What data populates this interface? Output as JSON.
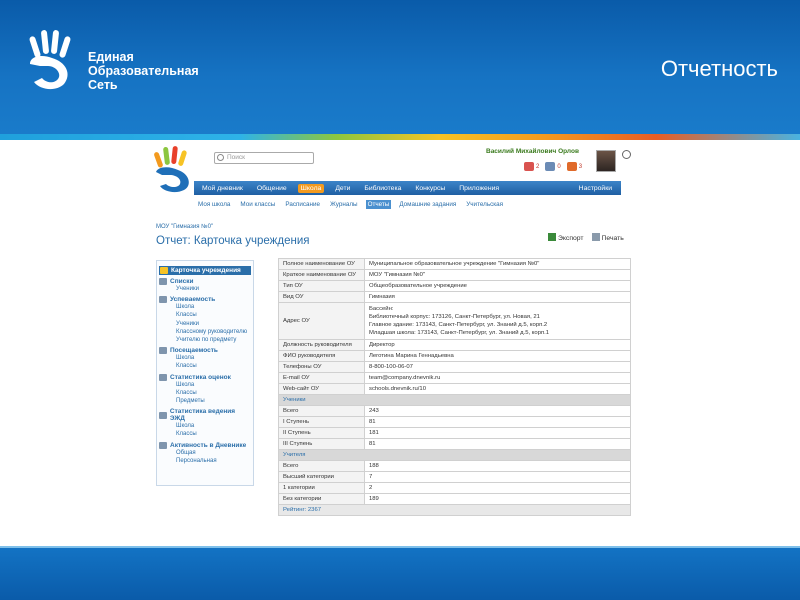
{
  "slide": {
    "title": "Отчетность",
    "logo_lines": [
      "Единая",
      "Образовательная",
      "Сеть"
    ]
  },
  "app": {
    "search_placeholder": "Поиск",
    "user_name": "Василий Михайлович Орлов",
    "badges": [
      {
        "name": "messages",
        "count": "2",
        "color": "#d9534f"
      },
      {
        "name": "friends",
        "count": "0",
        "color": "#6b8bb5"
      },
      {
        "name": "events",
        "count": "3",
        "color": "#e06a2a"
      }
    ],
    "nav": [
      "Мой дневник",
      "Общение",
      "Школа",
      "Дети",
      "Библиотека",
      "Конкурсы",
      "Приложения"
    ],
    "nav_active": "Школа",
    "nav_right": "Настройки",
    "subnav": [
      "Моя школа",
      "Мои классы",
      "Расписание",
      "Журналы",
      "Отчеты",
      "Домашние задания",
      "Учительская"
    ],
    "subnav_active": "Отчеты",
    "breadcrumb": "МОУ \"Гимназия №0\"",
    "page_title": "Отчет: Карточка учреждения",
    "export_label": "Экспорт",
    "print_label": "Печать"
  },
  "sidebar": [
    {
      "title": "Карточка учреждения",
      "active": true,
      "items": []
    },
    {
      "title": "Списки",
      "items": [
        "Ученики"
      ]
    },
    {
      "title": "Успеваемость",
      "items": [
        "Школа",
        "Классы",
        "Ученики",
        "Классному руководителю",
        "Учителю по предмету"
      ]
    },
    {
      "title": "Посещаемость",
      "items": [
        "Школа",
        "Классы"
      ]
    },
    {
      "title": "Статистика оценок",
      "items": [
        "Школа",
        "Классы",
        "Предметы"
      ]
    },
    {
      "title": "Статистика ведения ЭЖД",
      "items": [
        "Школа",
        "Классы"
      ]
    },
    {
      "title": "Активность в Дневнике",
      "items": [
        "Общая",
        "Персональная"
      ]
    }
  ],
  "table": [
    {
      "label": "Полное наименование ОУ",
      "value": "Муниципальное образовательное учреждение \"Гимназия №0\""
    },
    {
      "label": "Краткое наименование ОУ",
      "value": "МОУ \"Гимназия №0\""
    },
    {
      "label": "Тип ОУ",
      "value": "Общеобразовательное учреждение"
    },
    {
      "label": "Вид ОУ",
      "value": "Гимназия"
    },
    {
      "label": "Адрес ОУ",
      "value": "Бассейн:\nБиблиотечный корпус: 173126, Санкт-Петербург, ул. Новая, 21\nГлавное здание: 173143, Санкт-Петербург, ул. Знаний д.5, корп.2\nМладшая школа: 173143, Санкт-Петербург, ул. Знаний д.5, корп.1"
    },
    {
      "label": "Должность руководителя",
      "value": "Директор"
    },
    {
      "label": "ФИО руководителя",
      "value": "Леготина Марина Геннадьевна"
    },
    {
      "label": "Телефоны ОУ",
      "value": "8-800-100-06-07"
    },
    {
      "label": "E-mail ОУ",
      "value": "team@company.dnevnik.ru"
    },
    {
      "label": "Web-сайт ОУ",
      "value": "schools.dnevnik.ru/10"
    },
    {
      "group": "Ученики"
    },
    {
      "label": "Всего",
      "value": "243"
    },
    {
      "label": "I Ступень",
      "value": "81"
    },
    {
      "label": "II Ступень",
      "value": "181"
    },
    {
      "label": "III Ступень",
      "value": "81"
    },
    {
      "group": "Учителя"
    },
    {
      "label": "Всего",
      "value": "188"
    },
    {
      "label": "Высший категории",
      "value": "7"
    },
    {
      "label": "1 категории",
      "value": "2"
    },
    {
      "label": "Без категории",
      "value": "189"
    },
    {
      "footer": "Рейтинг: 2367"
    }
  ],
  "colors": {
    "banner": "#0a5ba9",
    "accent": "#f39a1e",
    "link": "#2a6ea9"
  }
}
